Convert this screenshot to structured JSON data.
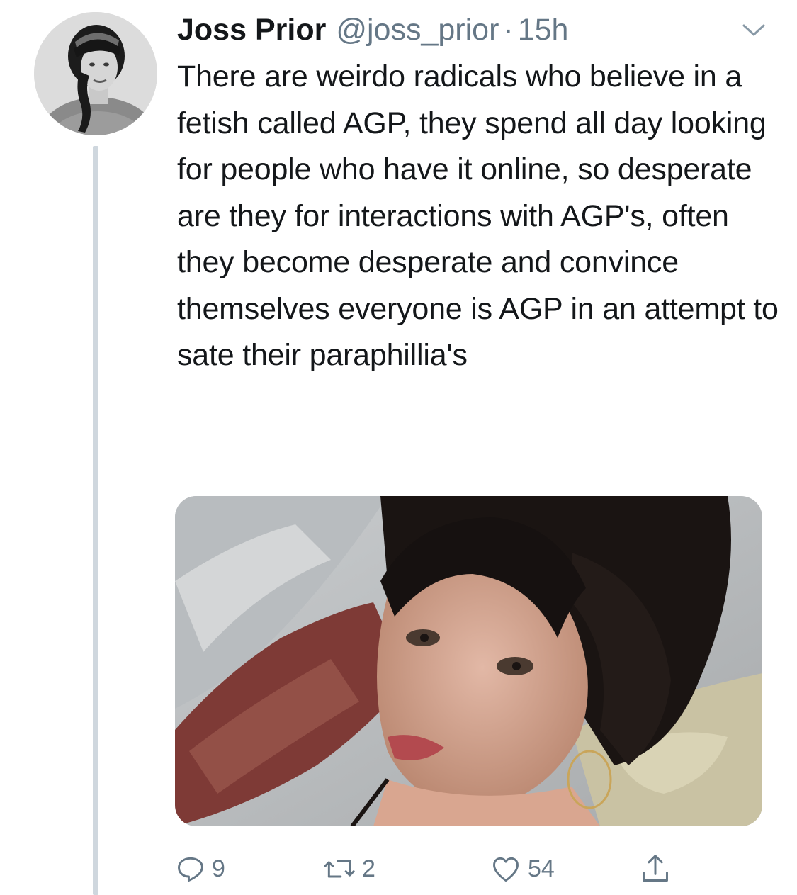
{
  "tweet": {
    "display_name": "Joss Prior",
    "handle": "@joss_prior",
    "separator": "·",
    "time": "15h",
    "text": "There are weirdo radicals who believe in a fetish called AGP, they spend all day looking for people who have it online, so desperate are they for interactions with AGP's, often they become desperate and convince themselves everyone is AGP in an attempt to sate their paraphillia's",
    "caret_icon": "chevron-down-icon",
    "media_alt": "",
    "actions": {
      "reply": {
        "icon": "reply-icon",
        "count": "9"
      },
      "retweet": {
        "icon": "retweet-icon",
        "count": "2"
      },
      "like": {
        "icon": "heart-icon",
        "count": "54"
      },
      "share": {
        "icon": "share-icon"
      }
    }
  },
  "colors": {
    "text": "#14171a",
    "secondary": "#657786",
    "thread_line": "#cfd7de",
    "background": "#ffffff"
  }
}
